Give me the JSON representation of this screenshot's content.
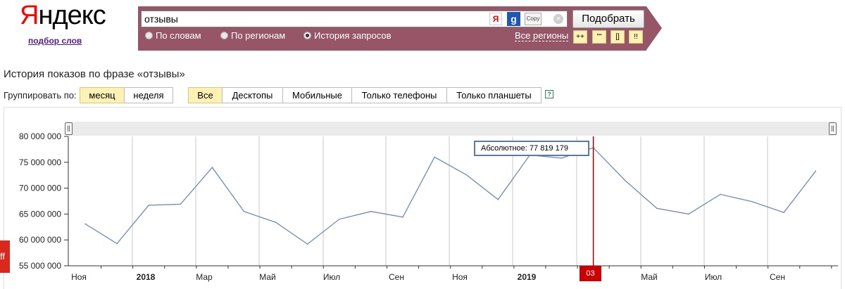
{
  "logo": {
    "first": "Я",
    "rest": "ндекс",
    "subtitle": "подбор слов"
  },
  "search": {
    "value": "отзывы",
    "icon_ya": "Я",
    "icon_g": "g",
    "icon_copy": "Copy",
    "icon_clear": "×",
    "submit_label": "Подобрать"
  },
  "modes": [
    {
      "label": "По словам",
      "checked": false
    },
    {
      "label": "По регионам",
      "checked": false
    },
    {
      "label": "История запросов",
      "checked": true
    }
  ],
  "regions_label": "Все регионы",
  "operators": [
    "++",
    "\"\"",
    "[]",
    "!!"
  ],
  "heading": "История показов по фразе «отзывы»",
  "grouping": {
    "label": "Группировать по:",
    "options": [
      "месяц",
      "неделя"
    ],
    "selected": "месяц"
  },
  "devices": {
    "options": [
      "Все",
      "Десктопы",
      "Мобильные",
      "Только телефоны",
      "Только планшеты"
    ],
    "selected": "Все",
    "help": "?"
  },
  "tooltip": "Абсолютное: 77 819 179",
  "cursor_label": "03",
  "left_tab_text": "ff",
  "colors": {
    "band": "#975668",
    "line": "#6f8ab0",
    "cursor": "#990000",
    "selected": "#fdf2b4"
  },
  "chart_data": {
    "type": "line",
    "ylim": [
      55000000,
      80000000
    ],
    "yticks": [
      "55 000 000",
      "60 000 000",
      "65 000 000",
      "70 000 000",
      "75 000 000",
      "80 000 000"
    ],
    "ytick_values": [
      55000000,
      60000000,
      65000000,
      70000000,
      75000000,
      80000000
    ],
    "xtick_labels": [
      "Ноя",
      "2018",
      "Мар",
      "Май",
      "Июл",
      "Сен",
      "Ноя",
      "2019",
      "Май",
      "Июл",
      "Сен"
    ],
    "xtick_bold": [
      "2018",
      "2019"
    ],
    "x": [
      "2017-11",
      "2017-12",
      "2018-01",
      "2018-02",
      "2018-03",
      "2018-04",
      "2018-05",
      "2018-06",
      "2018-07",
      "2018-08",
      "2018-09",
      "2018-10",
      "2018-11",
      "2018-12",
      "2019-01",
      "2019-02",
      "2019-03",
      "2019-04",
      "2019-05",
      "2019-06",
      "2019-07",
      "2019-08",
      "2019-09",
      "2019-10"
    ],
    "values": [
      63100000,
      59300000,
      66700000,
      66900000,
      74000000,
      65500000,
      63400000,
      59200000,
      64000000,
      65500000,
      64400000,
      76000000,
      72600000,
      67800000,
      76400000,
      75800000,
      77819179,
      71500000,
      66100000,
      65000000,
      68800000,
      67400000,
      65300000,
      73300000
    ],
    "highlight_index": 16,
    "grid": true
  }
}
